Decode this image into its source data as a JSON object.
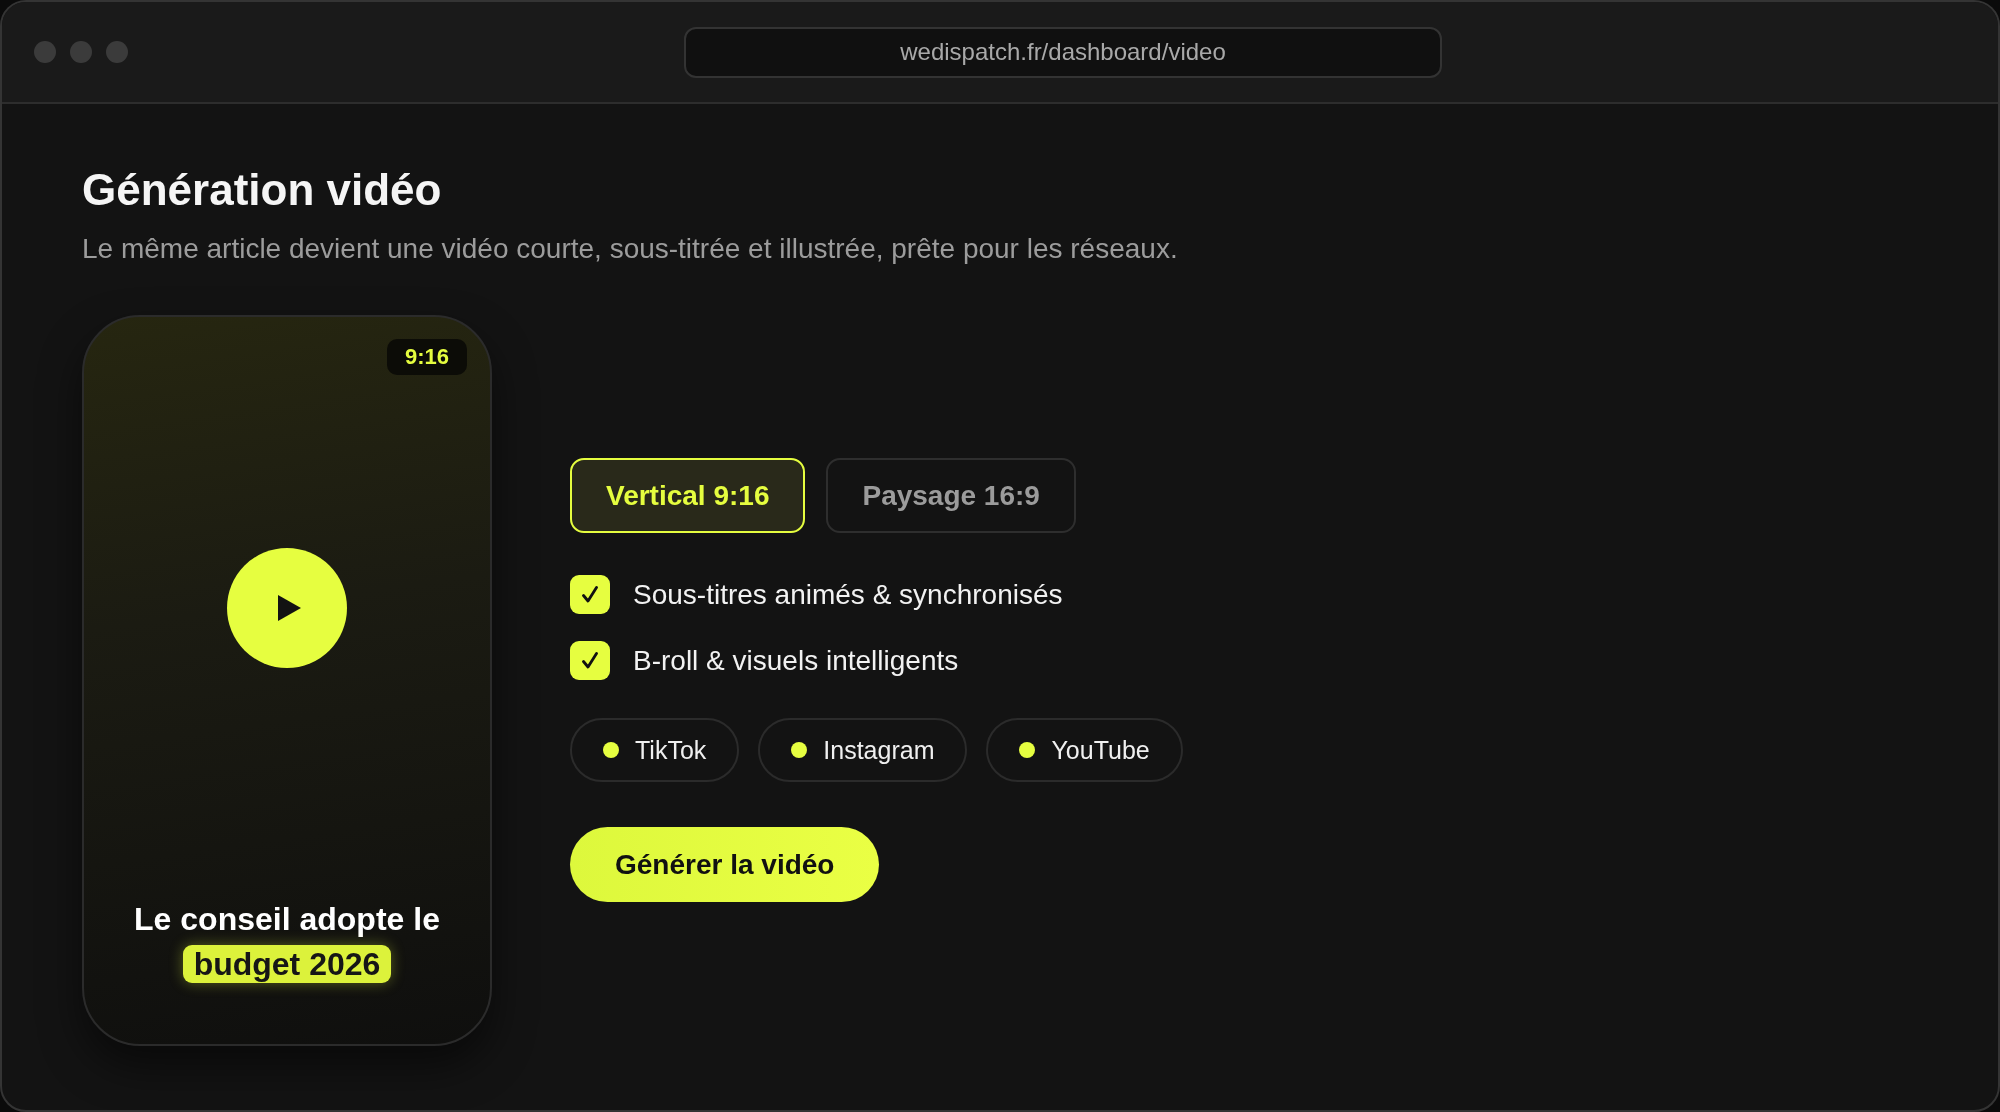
{
  "browser": {
    "url": "wedispatch.fr/dashboard/video"
  },
  "header": {
    "title": "Génération vidéo",
    "subtitle": "Le même article devient une vidéo courte, sous-titrée et illustrée, prête pour les réseaux."
  },
  "preview": {
    "ratio_badge": "9:16",
    "caption": "Le conseil adopte le",
    "caption_highlight": "budget 2026"
  },
  "formats": [
    {
      "label": "Vertical 9:16",
      "selected": true
    },
    {
      "label": "Paysage 16:9",
      "selected": false
    }
  ],
  "options": [
    {
      "label": "Sous-titres animés & synchronisés",
      "checked": true
    },
    {
      "label": "B-roll & visuels intelligents",
      "checked": true
    }
  ],
  "platforms": [
    {
      "label": "TikTok"
    },
    {
      "label": "Instagram"
    },
    {
      "label": "YouTube"
    }
  ],
  "generate_button": {
    "label": "Générer la vidéo"
  }
}
